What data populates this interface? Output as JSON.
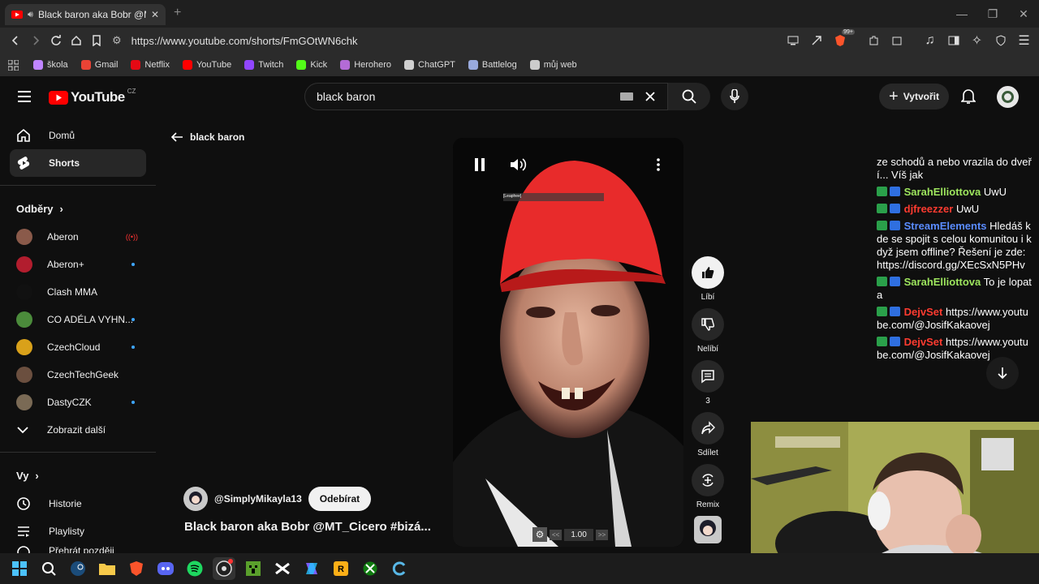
{
  "browser": {
    "tab_title": "Black baron aka Bobr @MT_C",
    "url": "https://www.youtube.com/shorts/FmGOtWN6chk",
    "bookmarks": [
      {
        "label": "škola",
        "color": "#c085ff"
      },
      {
        "label": "Gmail",
        "color": "#ea4335"
      },
      {
        "label": "Netflix",
        "color": "#e50914"
      },
      {
        "label": "YouTube",
        "color": "#ff0000"
      },
      {
        "label": "Twitch",
        "color": "#9146ff"
      },
      {
        "label": "Kick",
        "color": "#53fc18"
      },
      {
        "label": "Herohero",
        "color": "#b36bd6"
      },
      {
        "label": "ChatGPT",
        "color": "#d0d0d0"
      },
      {
        "label": "Battlelog",
        "color": "#9ad"
      },
      {
        "label": "můj web",
        "color": "#ccc"
      }
    ],
    "extension_badge": "99+"
  },
  "youtube": {
    "logo_text": "YouTube",
    "country": "CZ",
    "search_value": "black baron",
    "create_label": "Vytvořit",
    "back_label": "black baron"
  },
  "sidebar": {
    "home": "Domů",
    "shorts": "Shorts",
    "subscriptions_heading": "Odběry",
    "channels": [
      {
        "name": "Aberon",
        "status": "live",
        "color": "#8a5a4a"
      },
      {
        "name": "Aberon+",
        "status": "new",
        "color": "#b21d2e"
      },
      {
        "name": "Clash MMA",
        "status": "",
        "color": "#111"
      },
      {
        "name": "CO ADÉLA VYHN...",
        "status": "new",
        "color": "#4b8b3b"
      },
      {
        "name": "CzechCloud",
        "status": "new",
        "color": "#d9a11a"
      },
      {
        "name": "CzechTechGeek",
        "status": "",
        "color": "#6b4f3f"
      },
      {
        "name": "DastyCZK",
        "status": "new",
        "color": "#7a6a55"
      }
    ],
    "show_more": "Zobrazit další",
    "you_heading": "Vy",
    "history": "Historie",
    "playlists": "Playlisty",
    "watch_later": "Přehrát později"
  },
  "short": {
    "channel": "@SimplyMikayla13",
    "subscribe": "Odebírat",
    "title": "Black baron aka Bobr @MT_Cicero #bizá...",
    "like": "Líbí",
    "dislike": "Nelíbí",
    "comments": "3",
    "share": "Sdílet",
    "remix": "Remix",
    "speed": "1.00",
    "speed_down": "<<",
    "speed_up": ">>",
    "overlay_tag": "[Leaphee]"
  },
  "chat": [
    {
      "user": "",
      "text": "ze schodů a nebo vrazila do dveří... Víš jak",
      "color": ""
    },
    {
      "user": "SarahElliottova",
      "text": "UwU",
      "color": "#9ee65e"
    },
    {
      "user": "djfreezzer",
      "text": "UwU",
      "color": "#ff3b30"
    },
    {
      "user": "StreamElements",
      "text": "Hledáš kde se spojit s celou komunitou i když jsem offline? Řešení je zde: https://discord.gg/XEcSxN5PHv",
      "color": "#5a8cff"
    },
    {
      "user": "SarahElliottova",
      "text": "To je lopata",
      "color": "#9ee65e"
    },
    {
      "user": "DejvSet",
      "text": "https://www.youtube.com/@JosifKakaovej",
      "color": "#ff3b30"
    },
    {
      "user": "DejvSet",
      "text": "https://www.youtube.com/@JosifKakaovej",
      "color": "#ff3b30"
    }
  ]
}
